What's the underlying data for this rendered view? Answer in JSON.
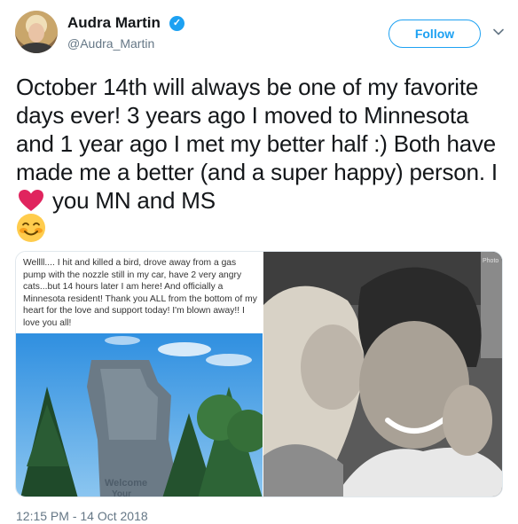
{
  "user": {
    "name": "Audra Martin",
    "handle": "@Audra_Martin",
    "verified_icon": "verified-badge-icon",
    "verified_color": "#1da1f2"
  },
  "actions": {
    "follow_label": "Follow",
    "more_icon": "chevron-down-icon"
  },
  "tweet": {
    "text_part1": "October 14th will always be one of my favorite days ever! 3 years ago I moved to Minnesota and 1 year ago I met my better half :) Both have made me a better (and a super happy) person. I",
    "heart_icon": "red-heart-emoji",
    "text_part2": "you MN and MS",
    "emoji_icon": "smiling-face-with-blush-emoji"
  },
  "media": {
    "left_caption": "Wellll.... I hit and killed a bird, drove away from a gas pump with the nozzle still in my car, have 2 very angry cats...but 14 hours later I am here! And officially a Minnesota resident! Thank you ALL from the bottom of my heart for the love and support today! I'm blown away!! I love you all!",
    "left_photo_sign_text": "Welcome",
    "left_photo_sign_text2": "Your",
    "right_photo_corner_text": "Photo"
  },
  "timestamp": "12:15 PM - 14 Oct 2018",
  "colors": {
    "link_blue": "#1da1f2",
    "meta_gray": "#657786",
    "heart_red": "#e0245e"
  }
}
